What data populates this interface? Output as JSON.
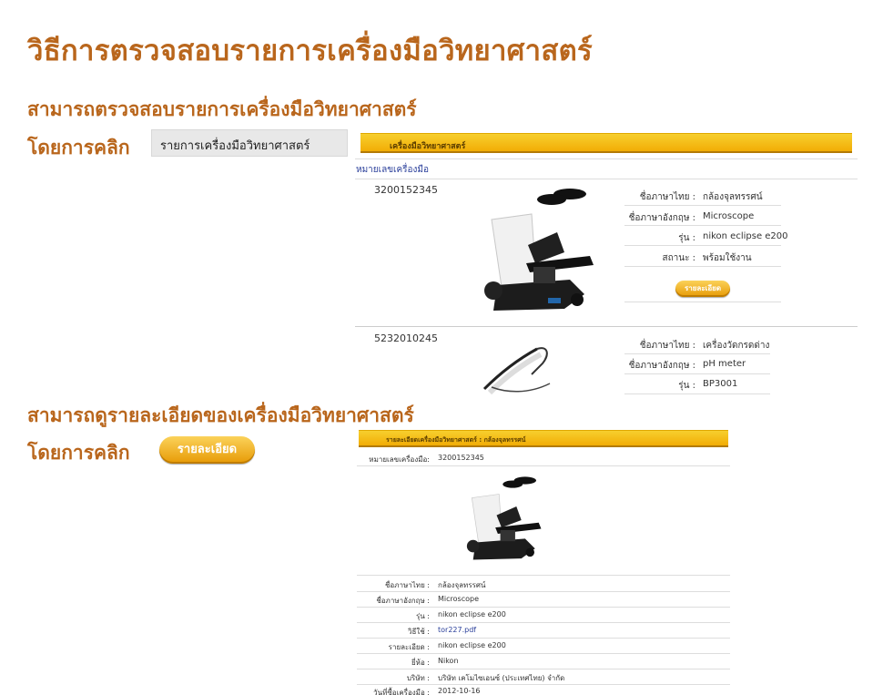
{
  "title": "วิธีการตรวจสอบรายการเครื่องมือวิทยาศาสตร์",
  "section1": {
    "heading": "สามารถตรวจสอบรายการเครื่องมือวิทยาศาสตร์",
    "click_label": "โดยการคลิก",
    "menu_item": "รายการเครื่องมือวิทยาศาสตร์"
  },
  "list_screenshot": {
    "header": "เครื่องมือวิทยาศาสตร์",
    "subheader": "หมายเลขเครื่องมือ",
    "items": [
      {
        "code": "3200152345",
        "fields": [
          {
            "label": "ชื่อภาษาไทย :",
            "value": "กล้องจุลทรรศน์"
          },
          {
            "label": "ชื่อภาษาอังกฤษ :",
            "value": "Microscope"
          },
          {
            "label": "รุ่น :",
            "value": "nikon eclipse e200"
          },
          {
            "label": "สถานะ :",
            "value": "พร้อมใช้งาน"
          }
        ],
        "button": "รายละเอียด"
      },
      {
        "code": "5232010245",
        "fields": [
          {
            "label": "ชื่อภาษาไทย :",
            "value": "เครื่องวัดกรดด่าง"
          },
          {
            "label": "ชื่อภาษาอังกฤษ :",
            "value": "pH meter"
          },
          {
            "label": "รุ่น :",
            "value": "BP3001"
          }
        ]
      }
    ]
  },
  "section2": {
    "heading": "สามารถดูรายละเอียดของเครื่องมือวิทยาศาสตร์",
    "click_label": "โดยการคลิก",
    "button": "รายละเอียด"
  },
  "detail_screenshot": {
    "header": "รายละเอียดเครื่องมือวิทยาศาสตร์ : กล้องจุลทรรศน์",
    "code_label": "หมายเลขเครื่องมือ:",
    "code_value": "3200152345",
    "fields": [
      {
        "label": "ชื่อภาษาไทย :",
        "value": "กล้องจุลทรรศน์"
      },
      {
        "label": "ชื่อภาษาอังกฤษ :",
        "value": "Microscope"
      },
      {
        "label": "รุ่น :",
        "value": "nikon eclipse e200"
      },
      {
        "label": "วิธีใช้ :",
        "value": "tor227.pdf",
        "link": true
      },
      {
        "label": "รายละเอียด :",
        "value": "nikon eclipse e200"
      },
      {
        "label": "ยี่ห้อ :",
        "value": "Nikon"
      },
      {
        "label": "บริษัท :",
        "value": "บริษัท เคโมไซเอนซ์ (ประเทศไทย) จำกัด"
      },
      {
        "label": "วันที่ซื้อเครื่องมือ :",
        "value": "2012-10-16"
      }
    ]
  },
  "colors": {
    "accent": "#b9661c",
    "gold": "#f2ad05",
    "link": "#2a3f9a"
  }
}
